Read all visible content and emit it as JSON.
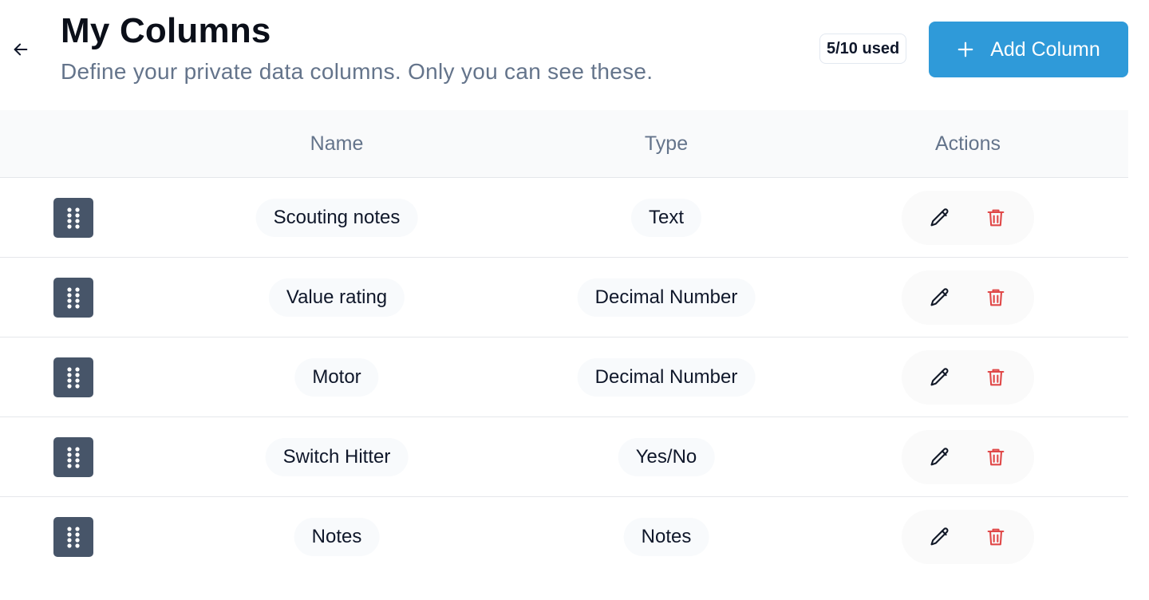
{
  "header": {
    "title": "My Columns",
    "subtitle": "Define your private data columns. Only you can see these.",
    "usage": "5/10 used",
    "add_label": "Add Column"
  },
  "table": {
    "columns": [
      "Name",
      "Type",
      "Actions"
    ],
    "rows": [
      {
        "name": "Scouting notes",
        "type": "Text"
      },
      {
        "name": "Value rating",
        "type": "Decimal Number"
      },
      {
        "name": "Motor",
        "type": "Decimal Number"
      },
      {
        "name": "Switch Hitter",
        "type": "Yes/No"
      },
      {
        "name": "Notes",
        "type": "Notes"
      }
    ]
  },
  "colors": {
    "accent": "#2f9ad9",
    "handle": "#475569",
    "delete": "#e04848"
  }
}
